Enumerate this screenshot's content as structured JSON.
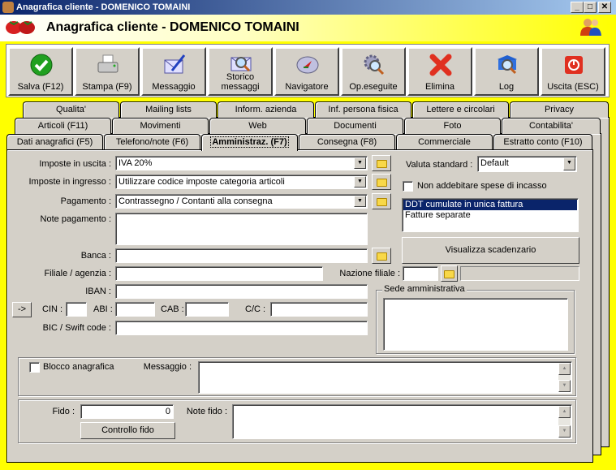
{
  "window": {
    "title": "Anagrafica cliente - DOMENICO TOMAINI",
    "minimize": "_",
    "maximize": "□",
    "close": "✕"
  },
  "header": {
    "title": "Anagrafica cliente - DOMENICO TOMAINI"
  },
  "toolbar": [
    {
      "label": "Salva (F12)",
      "icon": "check-icon"
    },
    {
      "label": "Stampa (F9)",
      "icon": "printer-icon"
    },
    {
      "label": "Messaggio",
      "icon": "envelope-pen-icon"
    },
    {
      "label": "Storico messaggi",
      "icon": "envelope-search-icon"
    },
    {
      "label": "Navigatore",
      "icon": "compass-icon"
    },
    {
      "label": "Op.eseguite",
      "icon": "gears-search-icon"
    },
    {
      "label": "Elimina",
      "icon": "delete-x-icon"
    },
    {
      "label": "Log",
      "icon": "book-search-icon"
    },
    {
      "label": "Uscita (ESC)",
      "icon": "power-icon"
    }
  ],
  "tabs": {
    "row1": [
      "Qualita'",
      "Mailing lists",
      "Inform. azienda",
      "Inf. persona fisica",
      "Lettere e circolari",
      "Privacy"
    ],
    "row2": [
      "Articoli (F11)",
      "Movimenti",
      "Web",
      "Documenti",
      "Foto",
      "Contabilita'"
    ],
    "row3": [
      "Dati anagrafici (F5)",
      "Telefono/note (F6)",
      "Amministraz. (F7)",
      "Consegna (F8)",
      "Commerciale",
      "Estratto conto (F10)"
    ],
    "active": "Amministraz. (F7)"
  },
  "form": {
    "imposte_uscita": {
      "label": "Imposte in uscita :",
      "value": "IVA 20%"
    },
    "imposte_ingresso": {
      "label": "Imposte in ingresso :",
      "value": "Utilizzare codice imposte categoria articoli"
    },
    "pagamento": {
      "label": "Pagamento :",
      "value": "Contrassegno / Contanti alla consegna"
    },
    "note_pagamento": {
      "label": "Note pagamento :",
      "value": ""
    },
    "banca": {
      "label": "Banca :",
      "value": ""
    },
    "filiale": {
      "label": "Filiale / agenzia :",
      "value": ""
    },
    "nazione_filiale": {
      "label": "Nazione filiale :",
      "value": ""
    },
    "iban": {
      "label": "IBAN :",
      "value": ""
    },
    "arrow_button": "->",
    "cin": {
      "label": "CIN :",
      "value": ""
    },
    "abi": {
      "label": "ABI :",
      "value": ""
    },
    "cab": {
      "label": "CAB :",
      "value": ""
    },
    "cc": {
      "label": "C/C :",
      "value": ""
    },
    "bic": {
      "label": "BIC / Swift code :",
      "value": ""
    },
    "valuta": {
      "label": "Valuta standard :",
      "value": "Default"
    },
    "non_addebitare": {
      "label": "Non addebitare spese di incasso",
      "checked": false
    },
    "fatturazione_options": [
      "DDT cumulate in unica fattura",
      "Fatture separate"
    ],
    "fatturazione_selected": "DDT cumulate in unica fattura",
    "visualizza_button": "Visualizza scadenzario",
    "sede_group": "Sede amministrativa",
    "blocco": {
      "label": "Blocco anagrafica",
      "checked": false
    },
    "messaggio": {
      "label": "Messaggio :",
      "value": ""
    },
    "fido": {
      "label": "Fido :",
      "value": "0"
    },
    "controllo_button": "Controllo fido",
    "note_fido": {
      "label": "Note fido :",
      "value": ""
    }
  }
}
